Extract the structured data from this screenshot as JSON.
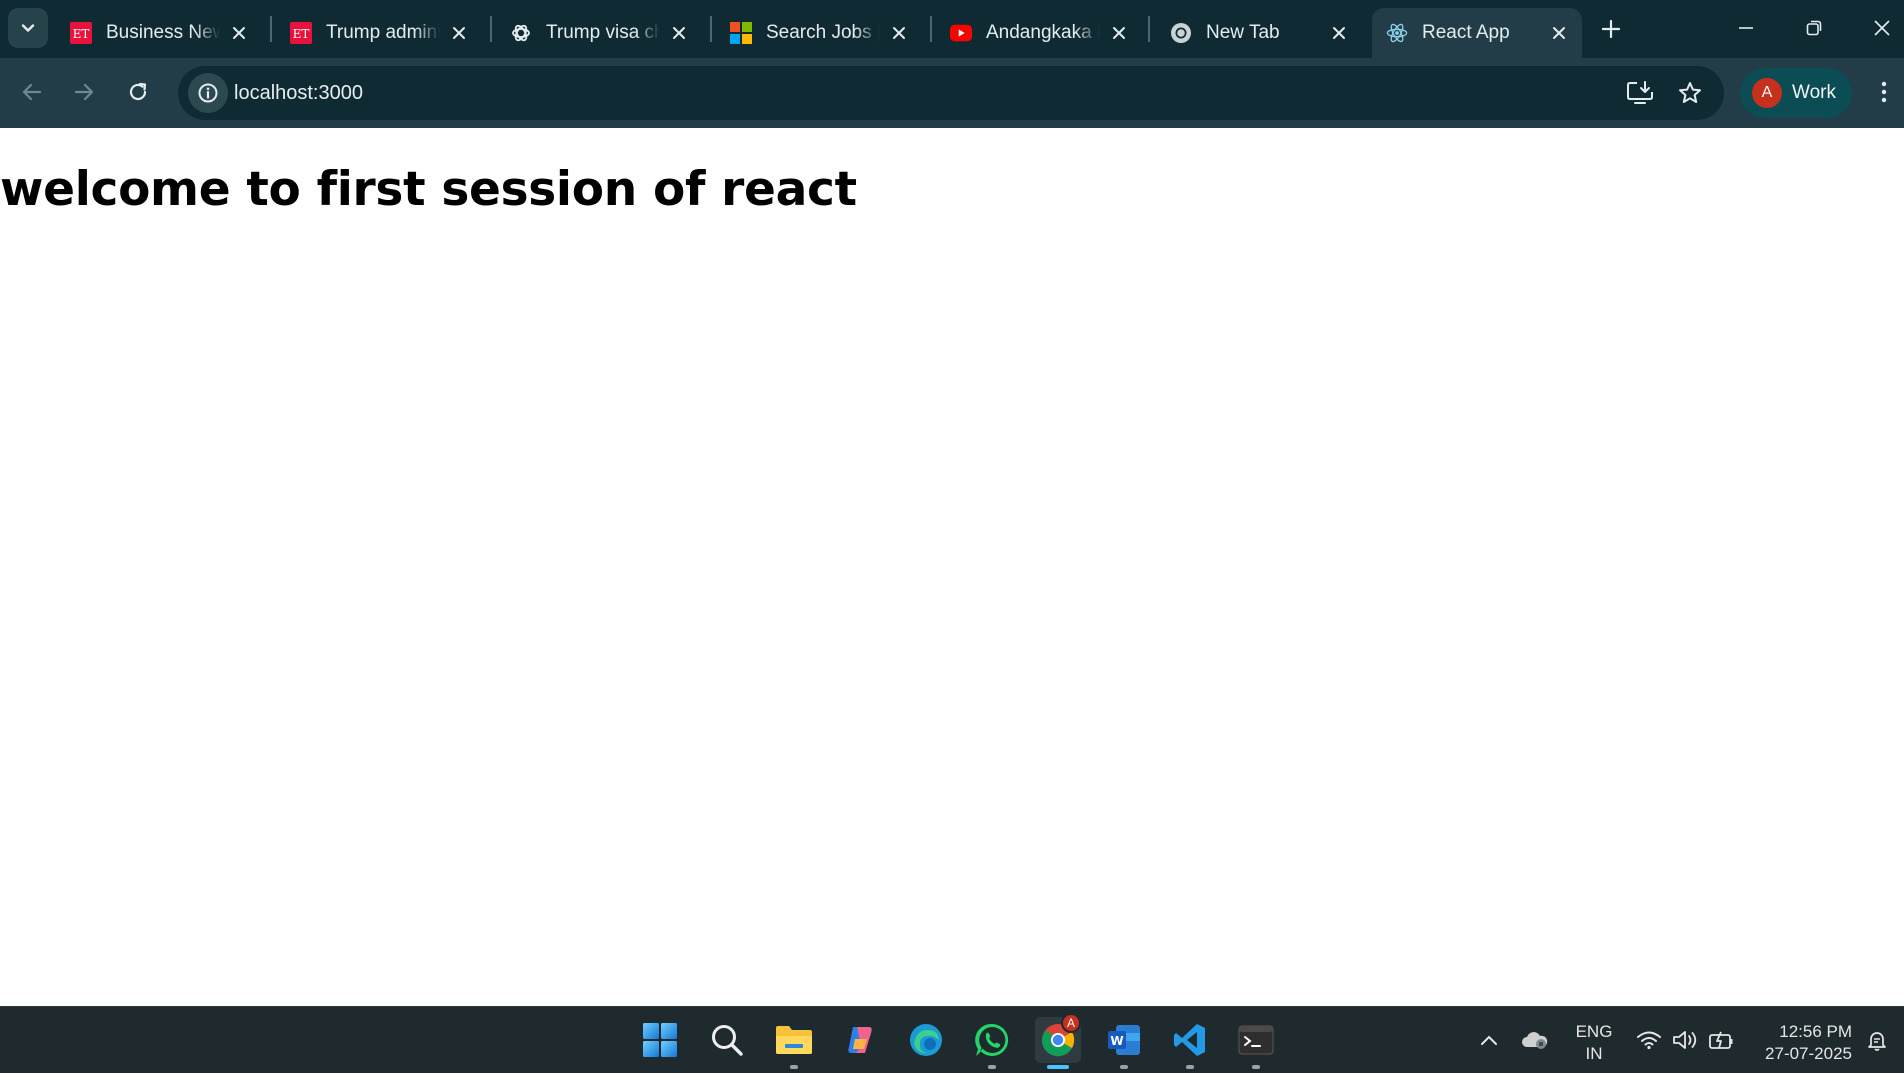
{
  "browser": {
    "tabs": [
      {
        "title": "Business News",
        "favicon": "et-icon",
        "active": false
      },
      {
        "title": "Trump administration",
        "favicon": "et-icon",
        "active": false
      },
      {
        "title": "Trump visa changes",
        "favicon": "openai-icon",
        "active": false
      },
      {
        "title": "Search Jobs | Microsoft",
        "favicon": "microsoft-icon",
        "active": false
      },
      {
        "title": "Andangkaka Kanitha",
        "favicon": "youtube-icon",
        "active": false
      },
      {
        "title": "New Tab",
        "favicon": "chrome-icon",
        "active": false
      },
      {
        "title": "React App",
        "favicon": "react-icon",
        "active": true
      }
    ],
    "address": "localhost:3000",
    "profile": {
      "initial": "A",
      "label": "Work"
    }
  },
  "page": {
    "heading": "welcome to first session of react"
  },
  "taskbar": {
    "apps": [
      "start",
      "search",
      "file-explorer",
      "copilot",
      "edge",
      "whatsapp",
      "chrome",
      "word",
      "vscode",
      "terminal"
    ],
    "chrome_badge": "A",
    "language": {
      "line1": "ENG",
      "line2": "IN"
    },
    "clock": {
      "time": "12:56 PM",
      "date": "27-07-2025"
    }
  },
  "colors": {
    "tabstrip": "#0f2a33",
    "toolbar": "#223d47",
    "profile_chip": "#0c4c55",
    "avatar": "#c6301c",
    "taskbar": "#1f2a2f"
  }
}
